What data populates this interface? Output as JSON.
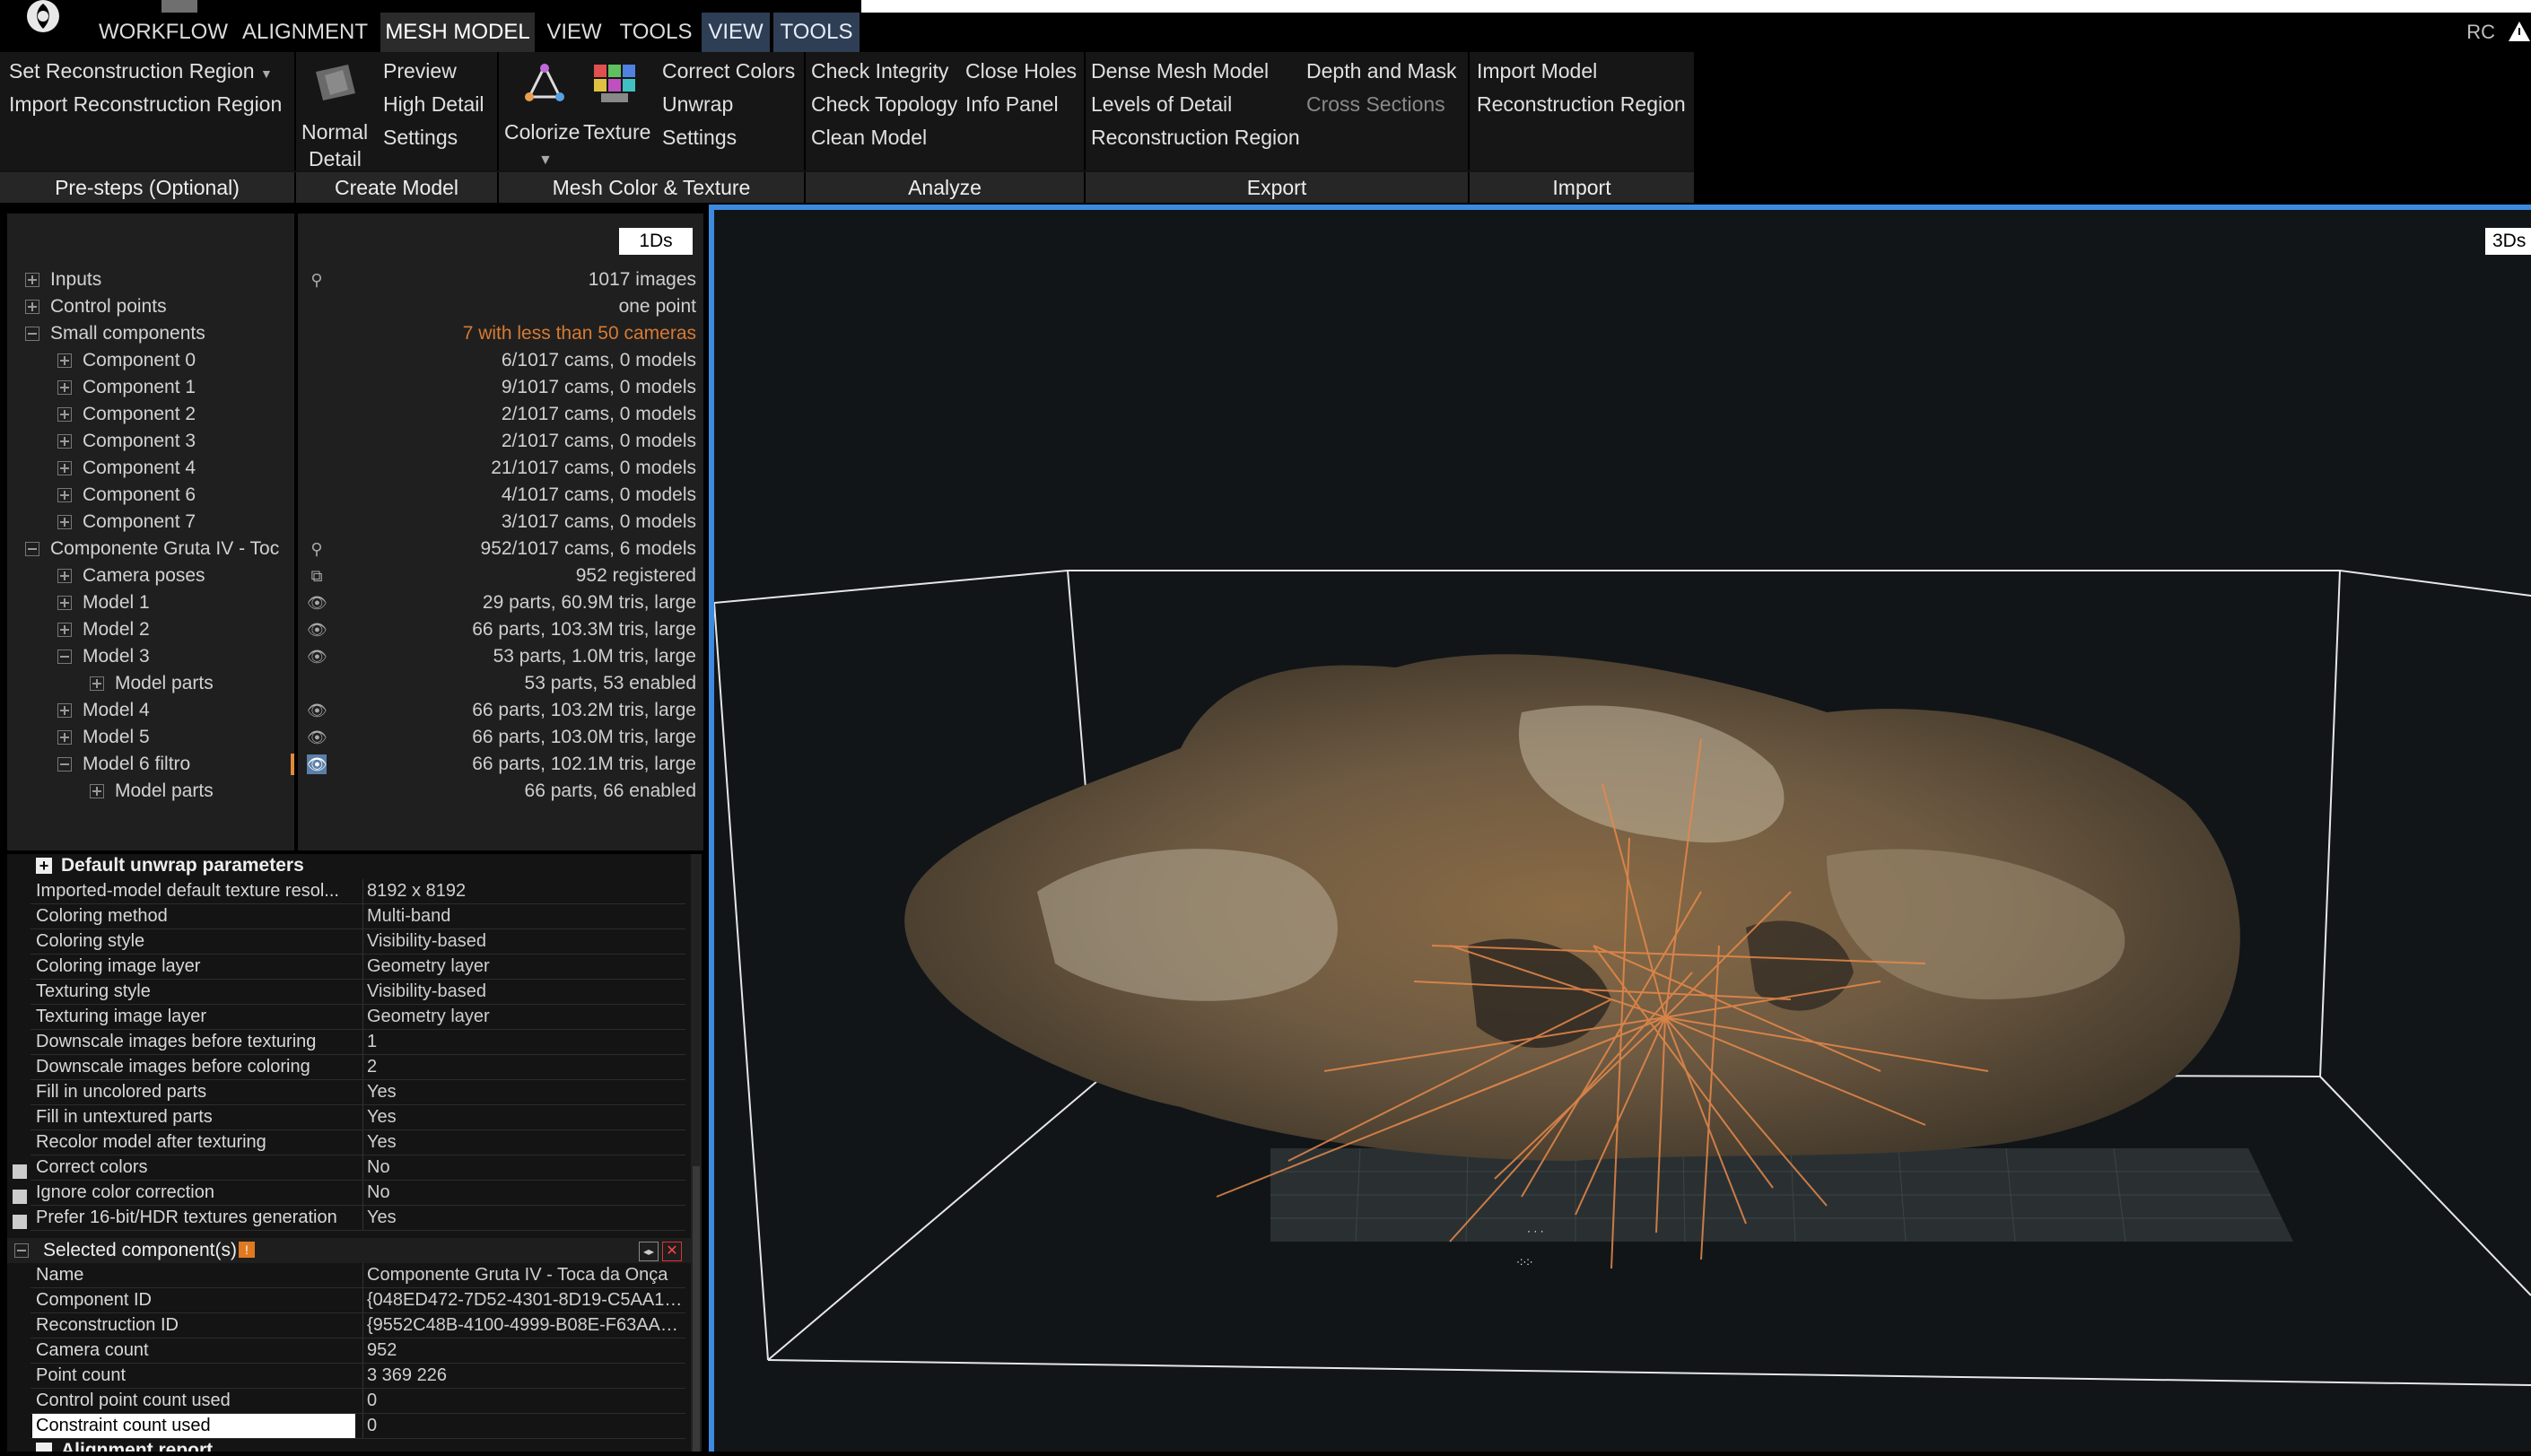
{
  "menu": {
    "items": [
      "WORKFLOW",
      "ALIGNMENT",
      "MESH MODEL",
      "VIEW",
      "TOOLS",
      "VIEW",
      "TOOLS"
    ],
    "corner": "RC"
  },
  "ribbon": {
    "pre_steps": {
      "label": "Pre-steps (Optional)",
      "b1": "Set Reconstruction Region",
      "b2": "Import Reconstruction Region"
    },
    "create_model": {
      "label": "Create Model",
      "normal": "Normal",
      "detail": "Detail",
      "preview": "Preview",
      "high_detail": "High Detail",
      "settings": "Settings"
    },
    "mesh_color": {
      "label": "Mesh Color & Texture",
      "colorize": "Colorize",
      "texture": "Texture",
      "correct_colors": "Correct Colors",
      "unwrap": "Unwrap",
      "settings": "Settings"
    },
    "analyze": {
      "label": "Analyze",
      "check_integrity": "Check Integrity",
      "check_topology": "Check Topology",
      "clean_model": "Clean Model",
      "close_holes": "Close Holes",
      "info_panel": "Info Panel"
    },
    "export": {
      "label": "Export",
      "dense_mesh": "Dense Mesh Model",
      "lod": "Levels of Detail",
      "recon_region": "Reconstruction Region",
      "depth_mask": "Depth and Mask",
      "cross_sections": "Cross Sections"
    },
    "import": {
      "label": "Import",
      "import_model": "Import Model",
      "recon_region": "Reconstruction Region"
    }
  },
  "tree": {
    "badge": "1Ds",
    "rows": [
      {
        "name": "Inputs",
        "value": "1017 images"
      },
      {
        "name": "Control points",
        "value": "one point"
      },
      {
        "name": "Small components",
        "value": "7 with less than 50 cameras"
      },
      {
        "name": "Component 0",
        "value": "6/1017 cams, 0 models"
      },
      {
        "name": "Component 1",
        "value": "9/1017 cams, 0 models"
      },
      {
        "name": "Component 2",
        "value": "2/1017 cams, 0 models"
      },
      {
        "name": "Component 3",
        "value": "2/1017 cams, 0 models"
      },
      {
        "name": "Component 4",
        "value": "21/1017 cams, 0 models"
      },
      {
        "name": "Component 6",
        "value": "4/1017 cams, 0 models"
      },
      {
        "name": "Component 7",
        "value": "3/1017 cams, 0 models"
      },
      {
        "name": "Componente Gruta IV  - Toc",
        "value": "952/1017 cams, 6 models"
      },
      {
        "name": "Camera poses",
        "value": "952 registered"
      },
      {
        "name": "Model 1",
        "value": "29 parts, 60.9M tris, large"
      },
      {
        "name": "Model 2",
        "value": "66 parts, 103.3M tris, large"
      },
      {
        "name": "Model 3",
        "value": "53 parts, 1.0M tris, large"
      },
      {
        "name": "Model parts",
        "value": "53 parts, 53 enabled"
      },
      {
        "name": "Model 4",
        "value": "66 parts, 103.2M tris, large"
      },
      {
        "name": "Model 5",
        "value": "66 parts, 103.0M tris, large"
      },
      {
        "name": "Model 6 filtro",
        "value": "66 parts, 102.1M tris, large"
      },
      {
        "name": "Model parts",
        "value": "66 parts, 66 enabled"
      }
    ]
  },
  "unwrap": {
    "title": "Default unwrap parameters",
    "rows": [
      {
        "k": "Imported-model default texture resol...",
        "v": "8192 x 8192"
      },
      {
        "k": "Coloring method",
        "v": "Multi-band"
      },
      {
        "k": "Coloring style",
        "v": "Visibility-based"
      },
      {
        "k": "Coloring image layer",
        "v": "Geometry layer"
      },
      {
        "k": "Texturing style",
        "v": "Visibility-based"
      },
      {
        "k": "Texturing image layer",
        "v": "Geometry layer"
      },
      {
        "k": "Downscale images before texturing",
        "v": "1"
      },
      {
        "k": "Downscale images before coloring",
        "v": "2"
      },
      {
        "k": "Fill in uncolored parts",
        "v": "Yes"
      },
      {
        "k": "Fill in untextured parts",
        "v": "Yes"
      },
      {
        "k": "Recolor model after texturing",
        "v": "Yes"
      },
      {
        "k": "Correct colors",
        "v": "No"
      },
      {
        "k": "Ignore color correction",
        "v": "No"
      },
      {
        "k": "Prefer 16-bit/HDR textures generation",
        "v": "Yes"
      }
    ]
  },
  "selected": {
    "title": "Selected component(s)",
    "rows": [
      {
        "k": "Name",
        "v": "Componente Gruta IV  - Toca da Onça"
      },
      {
        "k": "Component ID",
        "v": "{048ED472-7D52-4301-8D19-C5AA10..."
      },
      {
        "k": "Reconstruction ID",
        "v": "{9552C48B-4100-4999-B08E-F63AAC..."
      },
      {
        "k": "Camera count",
        "v": "952"
      },
      {
        "k": "Point count",
        "v": "3 369 226"
      },
      {
        "k": "Control point count used",
        "v": "0"
      },
      {
        "k": "Constraint count used",
        "v": "0"
      }
    ],
    "next": "Alignment report"
  },
  "view3d": {
    "badge": "3Ds"
  },
  "colors": {
    "accent": "#3d8ae0",
    "warning": "#d77a32",
    "rays": "#e8894a"
  }
}
